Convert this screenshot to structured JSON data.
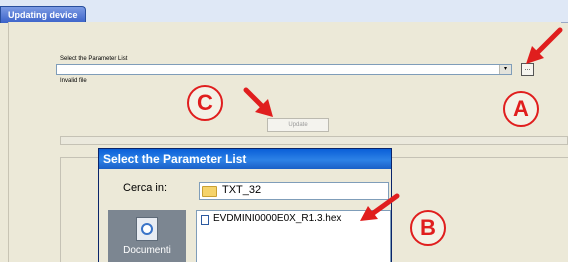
{
  "tab": {
    "title": "Updating device"
  },
  "form": {
    "param_label": "Select the Parameter List",
    "combo_value": "",
    "combo_arrow": "▾",
    "browse_label": "...",
    "error_text": "Invalid file",
    "update_label": "Update"
  },
  "dialog": {
    "title": "Select the Parameter List",
    "lookin_label": "Cerca in:",
    "lookin_value": "TXT_32",
    "places_label": "Documenti",
    "file_name": "EVDMINI0000E0X_R1.3.hex"
  },
  "annotations": {
    "a": "A",
    "b": "B",
    "c": "C",
    "color": "#e01e1e"
  }
}
